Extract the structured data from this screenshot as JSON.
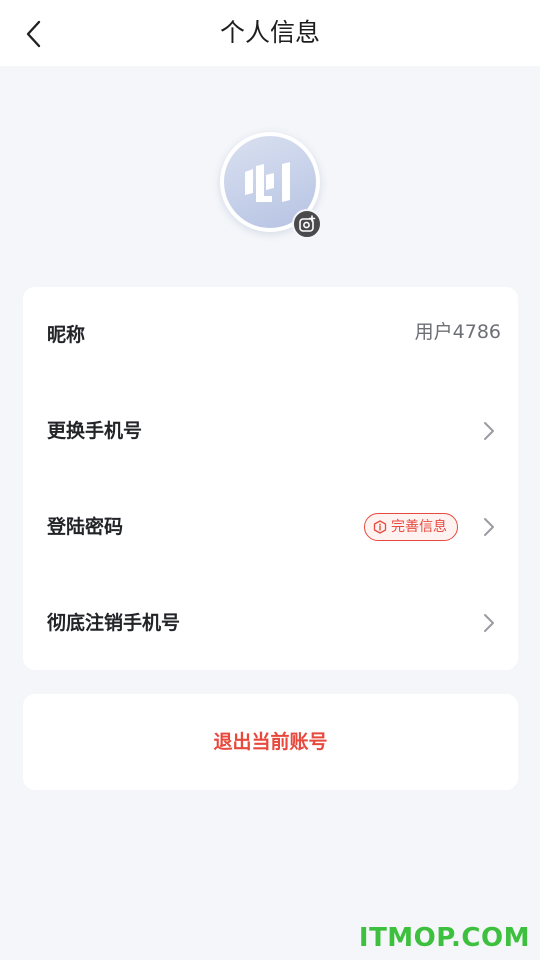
{
  "header": {
    "title": "个人信息",
    "back_icon": "chevron-left-icon"
  },
  "profile": {
    "avatar_icon": "app-logo",
    "camera_icon": "camera-icon"
  },
  "rows": [
    {
      "label": "昵称",
      "value": "用户4786"
    },
    {
      "label": "更换手机号"
    },
    {
      "label": "登陆密码",
      "badge": "完善信息"
    },
    {
      "label": "彻底注销手机号"
    }
  ],
  "logout": {
    "label": "退出当前账号"
  },
  "watermark": "ITMOP.COM",
  "colors": {
    "accent_red": "#e8493d",
    "background": "#f4f6f9",
    "card": "#ffffff"
  }
}
